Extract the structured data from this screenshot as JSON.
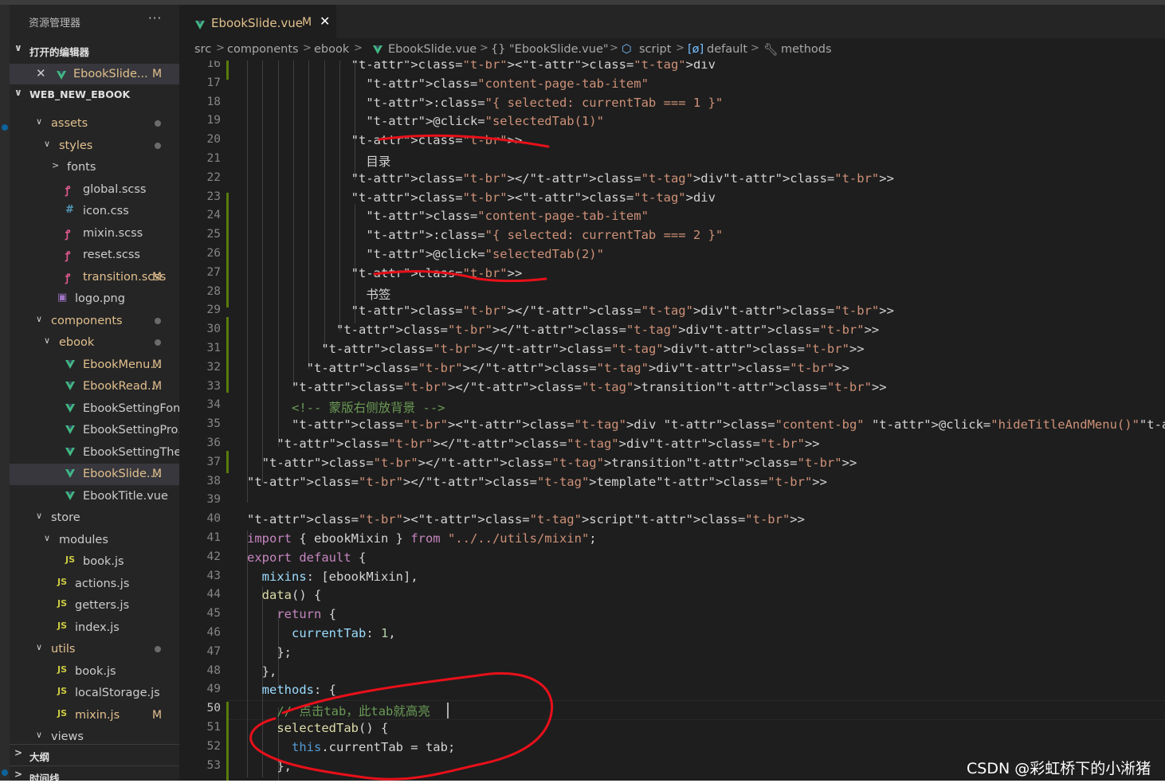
{
  "sidebar": {
    "title": "资源管理器",
    "more": "···",
    "open_editors": {
      "header": "打开的编辑器",
      "item": {
        "name": "EbookSlide...",
        "badge": "M",
        "close": "✕"
      }
    },
    "project": {
      "header": "WEB_NEW_EBOOK",
      "items": [
        {
          "name": "assets",
          "type": "folder",
          "open": true
        },
        {
          "name": "styles",
          "type": "folder",
          "open": true
        },
        {
          "name": "fonts",
          "type": "folder",
          "open": false
        },
        {
          "name": "global.scss",
          "type": "scss"
        },
        {
          "name": "icon.css",
          "type": "css"
        },
        {
          "name": "mixin.scss",
          "type": "scss"
        },
        {
          "name": "reset.scss",
          "type": "scss"
        },
        {
          "name": "transition.scss",
          "type": "scss",
          "badge": "M"
        },
        {
          "name": "logo.png",
          "type": "image"
        },
        {
          "name": "components",
          "type": "folder",
          "open": true
        },
        {
          "name": "ebook",
          "type": "folder",
          "open": true
        },
        {
          "name": "EbookMenu...",
          "type": "vue",
          "badge": "M"
        },
        {
          "name": "EbookRead...",
          "type": "vue",
          "badge": "M"
        },
        {
          "name": "EbookSettingFont...",
          "type": "vue"
        },
        {
          "name": "EbookSettingPro...",
          "type": "vue"
        },
        {
          "name": "EbookSettingThe...",
          "type": "vue"
        },
        {
          "name": "EbookSlide....",
          "type": "vue",
          "badge": "M",
          "selected": true
        },
        {
          "name": "EbookTitle.vue",
          "type": "vue"
        },
        {
          "name": "store",
          "type": "folder",
          "open": true
        },
        {
          "name": "modules",
          "type": "folder",
          "open": true
        },
        {
          "name": "book.js",
          "type": "js"
        },
        {
          "name": "actions.js",
          "type": "js"
        },
        {
          "name": "getters.js",
          "type": "js"
        },
        {
          "name": "index.js",
          "type": "js"
        },
        {
          "name": "utils",
          "type": "folder",
          "open": true
        },
        {
          "name": "book.js",
          "type": "js"
        },
        {
          "name": "localStorage.js",
          "type": "js"
        },
        {
          "name": "mixin.js",
          "type": "js",
          "badge": "M"
        },
        {
          "name": "views",
          "type": "folder",
          "open": true
        }
      ]
    },
    "outline_header": "大纲",
    "timeline_header": "时间线"
  },
  "tab": {
    "name": "EbookSlide.vue",
    "badge": "M",
    "close": "✕"
  },
  "breadcrumb": [
    "src",
    "components",
    "ebook",
    "EbookSlide.vue",
    "\"EbookSlide.vue\"",
    "script",
    "default",
    "methods"
  ],
  "editor": {
    "line_numbers": [
      "16",
      "17",
      "18",
      "19",
      "20",
      "21",
      "22",
      "23",
      "24",
      "25",
      "26",
      "27",
      "28",
      "29",
      "30",
      "31",
      "32",
      "33",
      "34",
      "35",
      "36",
      "37",
      "38",
      "39",
      "40",
      "41",
      "42",
      "43",
      "44",
      "45",
      "46",
      "47",
      "48",
      "49",
      "50",
      "51",
      "52",
      "53"
    ],
    "active_line": "50",
    "lines": [
      "              <div",
      "                class=\"content-page-tab-item\"",
      "                :class=\"{ selected: currentTab === 1 }\"",
      "                @click=\"selectedTab(1)\"",
      "              >",
      "                目录",
      "              </div>",
      "              <div",
      "                class=\"content-page-tab-item\"",
      "                :class=\"{ selected: currentTab === 2 }\"",
      "                @click=\"selectedTab(2)\"",
      "              >",
      "                书签",
      "              </div>",
      "            </div>",
      "          </div>",
      "        </div>",
      "      </transition>",
      "      <!-- 蒙版右侧放背景 -->",
      "      <div class=\"content-bg\" @click=\"hideTitleAndMenu()\"></div>",
      "    </div>",
      "  </transition>",
      "</template>",
      "",
      "<script>",
      "import { ebookMixin } from \"../../utils/mixin\";",
      "export default {",
      "  mixins: [ebookMixin],",
      "  data() {",
      "    return {",
      "      currentTab: 1,",
      "    };",
      "  },",
      "  methods: {",
      "    // 点击tab，此tab就高亮",
      "    selectedTab() {",
      "      this.currentTab = tab;",
      "    },"
    ]
  },
  "watermark": "CSDN @彩虹桥下的小淅猪"
}
